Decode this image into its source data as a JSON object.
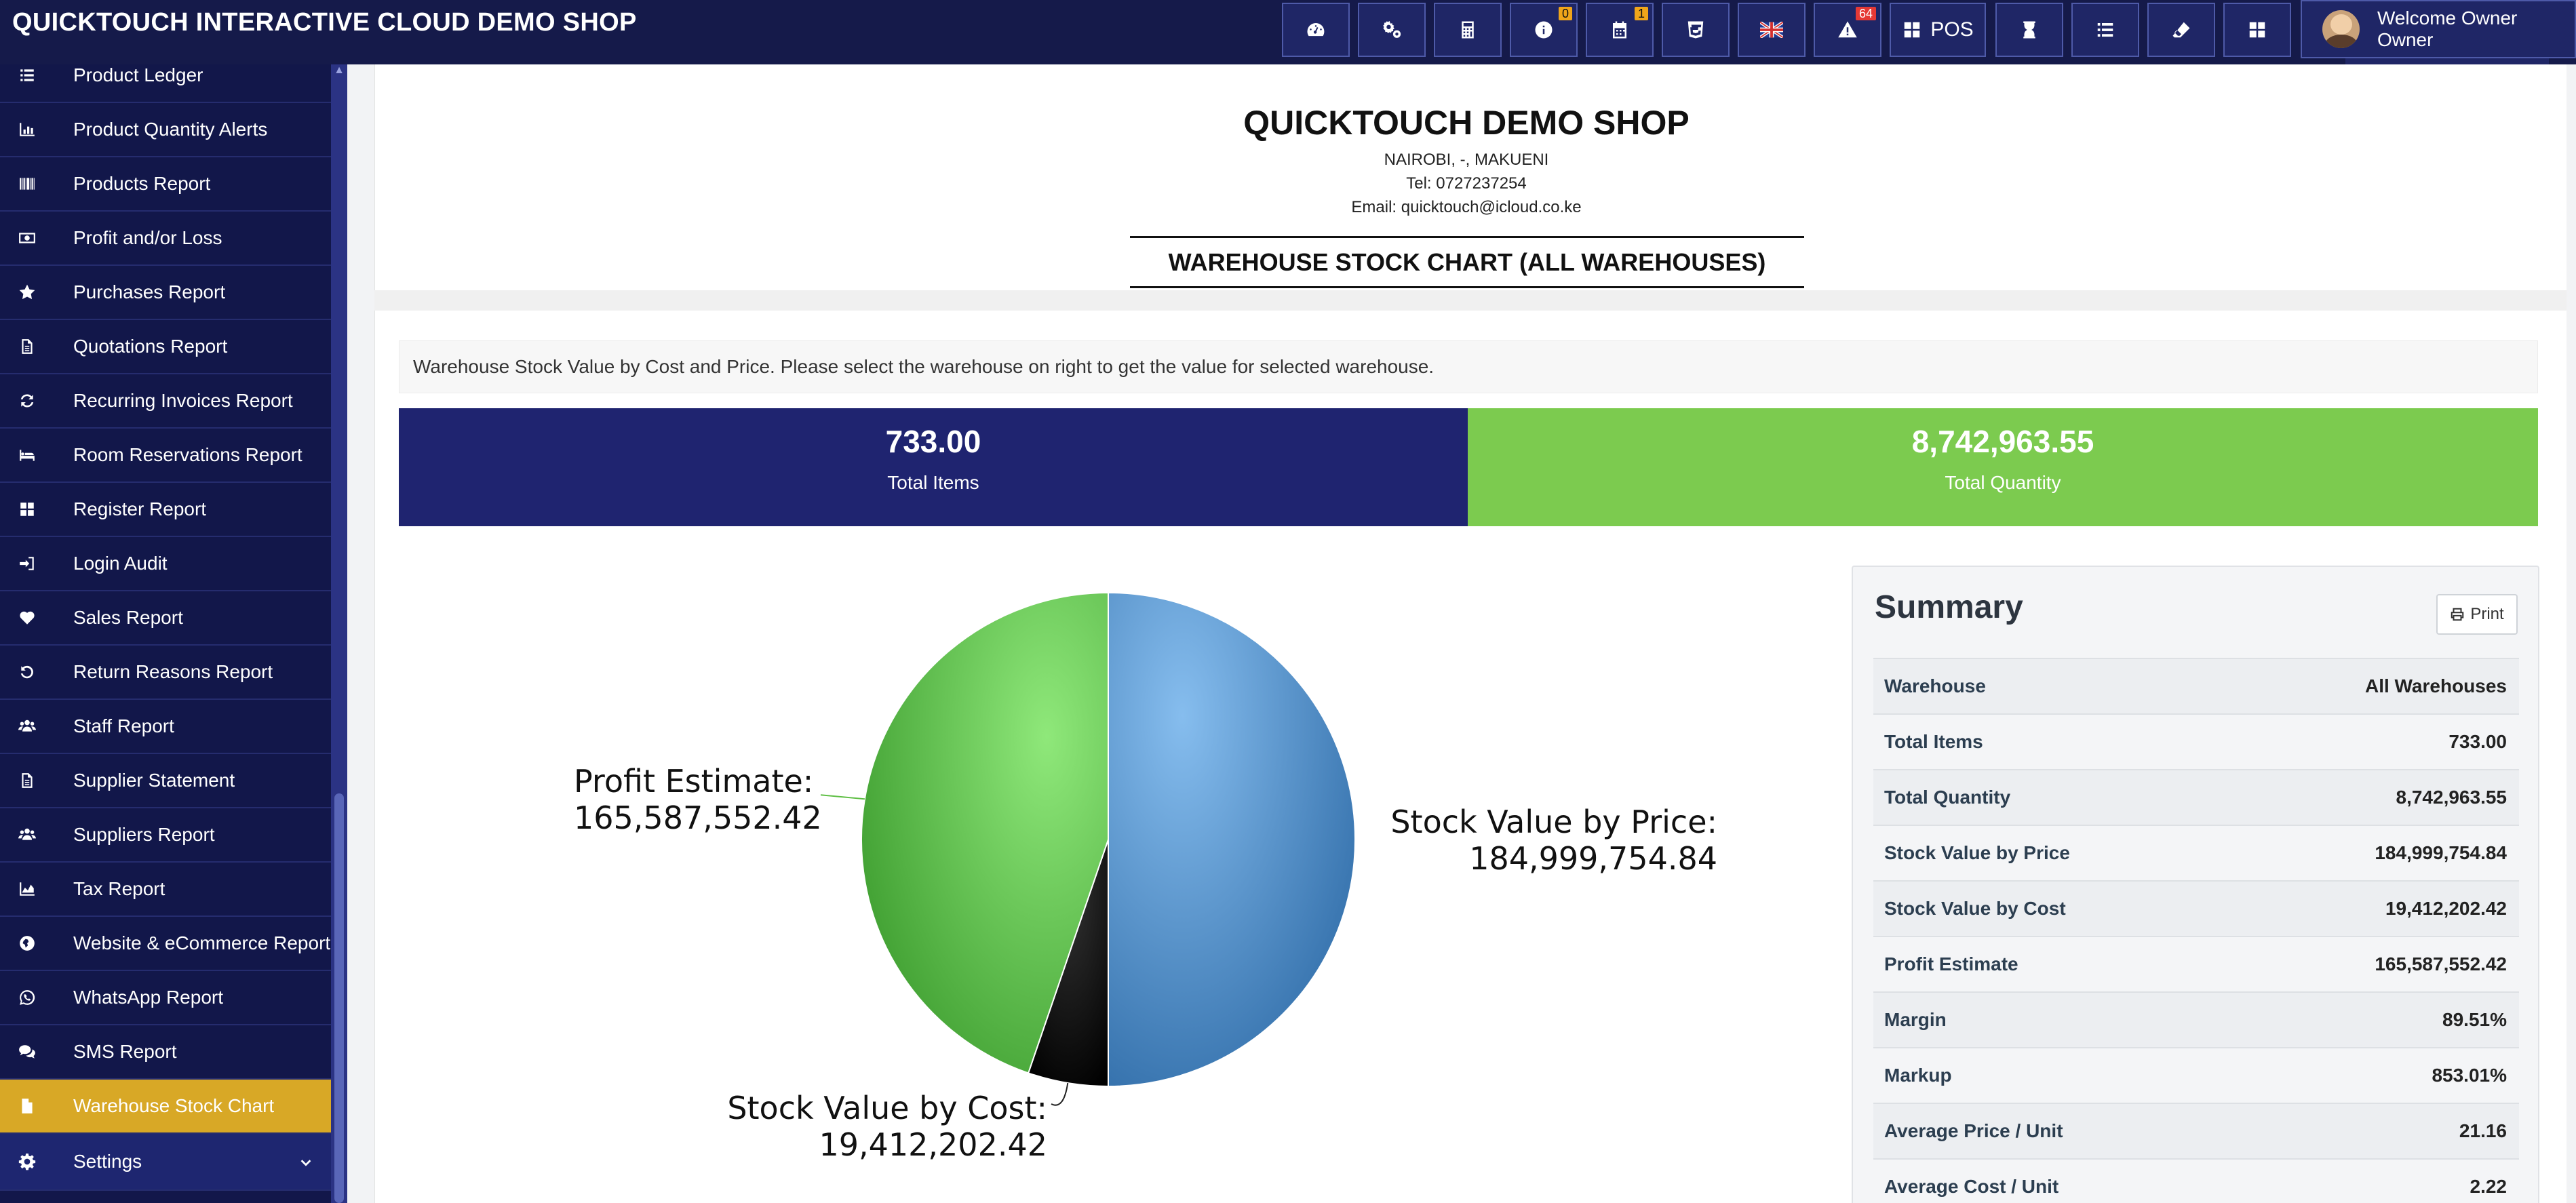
{
  "app": {
    "brand": "QUICKTOUCH INTERACTIVE CLOUD DEMO SHOP"
  },
  "topbar": {
    "buttons": [
      {
        "name": "dashboard",
        "icon": "gauge-icon",
        "badge": ""
      },
      {
        "name": "integrations",
        "icon": "cogs-icon",
        "badge": ""
      },
      {
        "name": "calculator",
        "icon": "calculator-icon",
        "badge": ""
      },
      {
        "name": "info",
        "icon": "info-icon",
        "badge": "0"
      },
      {
        "name": "calendar",
        "icon": "calendar-icon",
        "badge": "1"
      },
      {
        "name": "theme",
        "icon": "css-icon",
        "badge": ""
      },
      {
        "name": "language",
        "icon": "flag-uk-icon",
        "badge": ""
      },
      {
        "name": "alerts",
        "icon": "warning-icon",
        "badge": "64"
      },
      {
        "name": "pos",
        "icon": "grid-icon",
        "label": "POS"
      },
      {
        "name": "timer",
        "icon": "hourglass-icon",
        "badge": ""
      },
      {
        "name": "list",
        "icon": "list-icon",
        "badge": ""
      },
      {
        "name": "eraser",
        "icon": "eraser-icon",
        "badge": ""
      },
      {
        "name": "apps",
        "icon": "grid-icon",
        "badge": ""
      }
    ],
    "user_label": "Welcome Owner Owner"
  },
  "sidebar": {
    "items": [
      {
        "label": "Product Ledger",
        "icon": "list-icon"
      },
      {
        "label": "Product Quantity Alerts",
        "icon": "bar-chart-icon"
      },
      {
        "label": "Products Report",
        "icon": "barcode-icon"
      },
      {
        "label": "Profit and/or Loss",
        "icon": "money-icon"
      },
      {
        "label": "Purchases Report",
        "icon": "star-icon"
      },
      {
        "label": "Quotations Report",
        "icon": "document-icon"
      },
      {
        "label": "Recurring Invoices Report",
        "icon": "refresh-icon"
      },
      {
        "label": "Room Reservations Report",
        "icon": "bed-icon"
      },
      {
        "label": "Register Report",
        "icon": "grid-icon"
      },
      {
        "label": "Login Audit",
        "icon": "sign-in-icon"
      },
      {
        "label": "Sales Report",
        "icon": "heart-icon"
      },
      {
        "label": "Return Reasons Report",
        "icon": "undo-icon"
      },
      {
        "label": "Staff Report",
        "icon": "users-icon"
      },
      {
        "label": "Supplier Statement",
        "icon": "document-icon"
      },
      {
        "label": "Suppliers Report",
        "icon": "users-icon"
      },
      {
        "label": "Tax Report",
        "icon": "area-chart-icon"
      },
      {
        "label": "Website & eCommerce Report",
        "icon": "globe-icon"
      },
      {
        "label": "WhatsApp Report",
        "icon": "whatsapp-icon"
      },
      {
        "label": "SMS Report",
        "icon": "comments-icon"
      },
      {
        "label": "Warehouse Stock Chart",
        "icon": "file-icon",
        "active": true
      },
      {
        "label": "Settings",
        "icon": "gear-icon",
        "expandable": true
      }
    ]
  },
  "report": {
    "shop_name": "QUICKTOUCH DEMO SHOP",
    "address": "NAIROBI, -, MAKUENI",
    "tel": "Tel: 0727237254",
    "email": "Email: quicktouch@icloud.co.ke",
    "title": "WAREHOUSE STOCK CHART (ALL WAREHOUSES)",
    "info": "Warehouse Stock Value by Cost and Price. Please select the warehouse on right to get the value for selected warehouse."
  },
  "stats": {
    "total_items_value": "733.00",
    "total_items_label": "Total Items",
    "total_quantity_value": "8,742,963.55",
    "total_quantity_label": "Total Quantity"
  },
  "chart_data": {
    "type": "pie",
    "slices": [
      {
        "label": "Stock Value by Price:",
        "value": 184999754.84,
        "display": "184,999,754.84",
        "color": "#4e8fcf"
      },
      {
        "label": "Stock Value by Cost:",
        "value": 19412202.42,
        "display": "19,412,202.42",
        "color": "#111111"
      },
      {
        "label": "Profit Estimate:",
        "value": 165587552.42,
        "display": "165,587,552.42",
        "color": "#5fbf45"
      }
    ]
  },
  "summary": {
    "title": "Summary",
    "print_label": "Print",
    "rows": [
      {
        "key": "Warehouse",
        "value": "All Warehouses"
      },
      {
        "key": "Total Items",
        "value": "733.00"
      },
      {
        "key": "Total Quantity",
        "value": "8,742,963.55"
      },
      {
        "key": "Stock Value by Price",
        "value": "184,999,754.84"
      },
      {
        "key": "Stock Value by Cost",
        "value": "19,412,202.42"
      },
      {
        "key": "Profit Estimate",
        "value": "165,587,552.42"
      },
      {
        "key": "Margin",
        "value": "89.51%"
      },
      {
        "key": "Markup",
        "value": "853.01%"
      },
      {
        "key": "Average Price / Unit",
        "value": "21.16"
      },
      {
        "key": "Average Cost / Unit",
        "value": "2.22"
      }
    ]
  }
}
